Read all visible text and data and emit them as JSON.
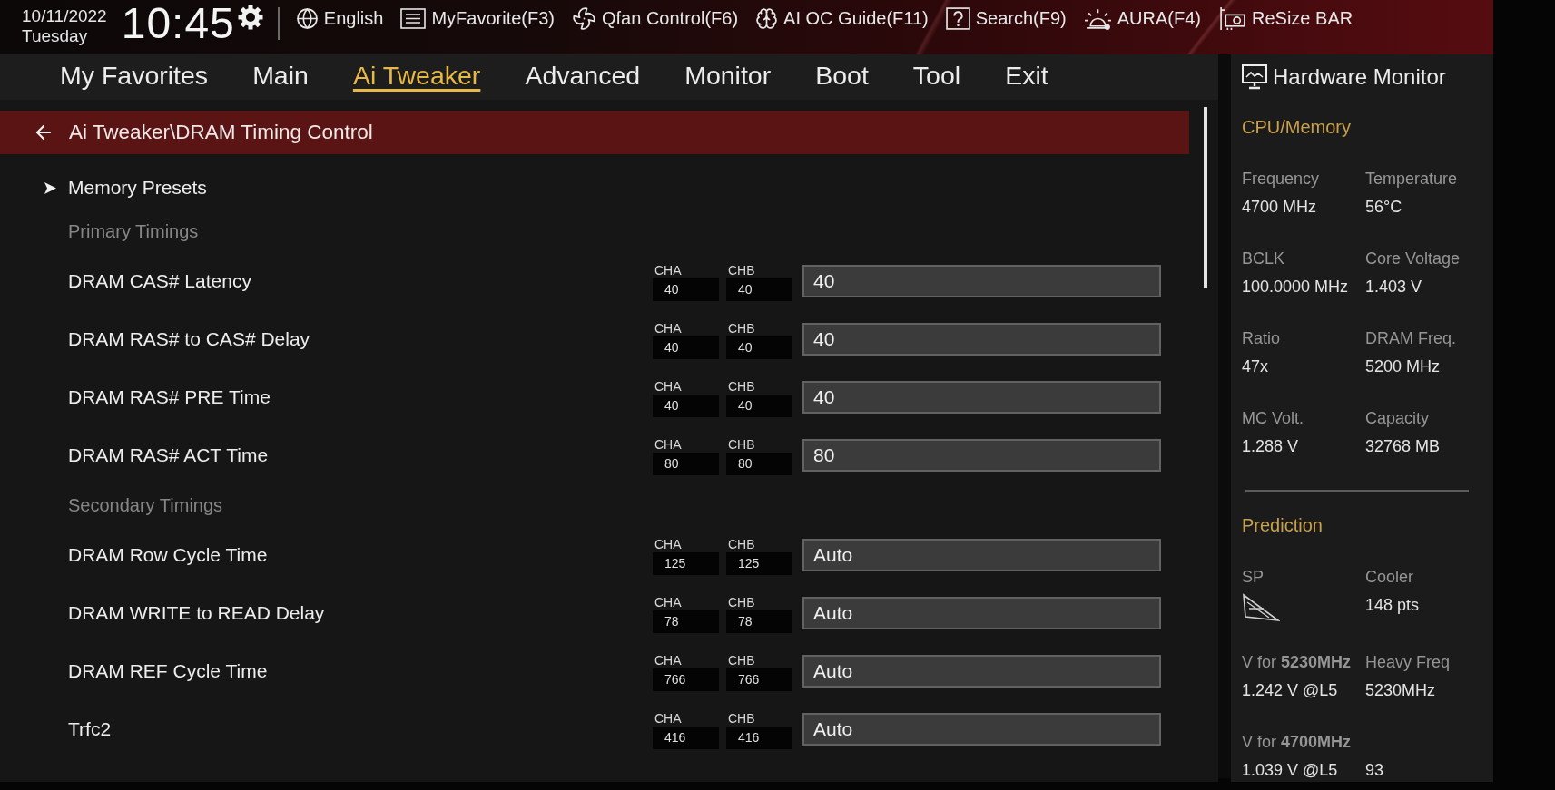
{
  "header": {
    "date": "10/11/2022",
    "day": "Tuesday",
    "time": "10:45",
    "tools": [
      {
        "kind": "language",
        "label": "English"
      },
      {
        "kind": "favorite",
        "label": "MyFavorite(F3)"
      },
      {
        "kind": "fan",
        "label": "Qfan Control(F6)"
      },
      {
        "kind": "guide",
        "label": "AI OC Guide(F11)"
      },
      {
        "kind": "search",
        "label": "Search(F9)"
      },
      {
        "kind": "aura",
        "label": "AURA(F4)"
      },
      {
        "kind": "resize",
        "label": "ReSize BAR"
      }
    ]
  },
  "menu": [
    {
      "label": "My Favorites",
      "selected": false
    },
    {
      "label": "Main",
      "selected": false
    },
    {
      "label": "Ai Tweaker",
      "selected": true
    },
    {
      "label": "Advanced",
      "selected": false
    },
    {
      "label": "Monitor",
      "selected": false
    },
    {
      "label": "Boot",
      "selected": false
    },
    {
      "label": "Tool",
      "selected": false
    },
    {
      "label": "Exit",
      "selected": false
    }
  ],
  "breadcrumb": "Ai Tweaker\\DRAM Timing Control",
  "items": [
    {
      "kind": "submenu",
      "label": "Memory Presets"
    },
    {
      "kind": "heading",
      "label": "Primary Timings"
    },
    {
      "kind": "timing",
      "label": "DRAM CAS# Latency",
      "channels": [
        {
          "name": "CHA",
          "value": "40"
        },
        {
          "name": "CHB",
          "value": "40"
        }
      ],
      "value": "40"
    },
    {
      "kind": "timing",
      "label": "DRAM RAS# to CAS# Delay",
      "channels": [
        {
          "name": "CHA",
          "value": "40"
        },
        {
          "name": "CHB",
          "value": "40"
        }
      ],
      "value": "40"
    },
    {
      "kind": "timing",
      "label": "DRAM RAS# PRE Time",
      "channels": [
        {
          "name": "CHA",
          "value": "40"
        },
        {
          "name": "CHB",
          "value": "40"
        }
      ],
      "value": "40"
    },
    {
      "kind": "timing",
      "label": "DRAM RAS# ACT Time",
      "channels": [
        {
          "name": "CHA",
          "value": "80"
        },
        {
          "name": "CHB",
          "value": "80"
        }
      ],
      "value": "80"
    },
    {
      "kind": "heading",
      "label": "Secondary Timings"
    },
    {
      "kind": "timing",
      "label": "DRAM Row Cycle Time",
      "channels": [
        {
          "name": "CHA",
          "value": "125"
        },
        {
          "name": "CHB",
          "value": "125"
        }
      ],
      "value": "Auto"
    },
    {
      "kind": "timing",
      "label": "DRAM WRITE to READ Delay",
      "channels": [
        {
          "name": "CHA",
          "value": "78"
        },
        {
          "name": "CHB",
          "value": "78"
        }
      ],
      "value": "Auto"
    },
    {
      "kind": "timing",
      "label": "DRAM REF Cycle Time",
      "channels": [
        {
          "name": "CHA",
          "value": "766"
        },
        {
          "name": "CHB",
          "value": "766"
        }
      ],
      "value": "Auto"
    },
    {
      "kind": "timing",
      "label": "Trfc2",
      "channels": [
        {
          "name": "CHA",
          "value": "416"
        },
        {
          "name": "CHB",
          "value": "416"
        }
      ],
      "value": "Auto"
    }
  ],
  "monitor": {
    "title": "Hardware Monitor",
    "sections": [
      {
        "title": "CPU/Memory",
        "stats": [
          {
            "kind": "text",
            "label": "Frequency",
            "value": "4700 MHz"
          },
          {
            "kind": "text",
            "label": "Temperature",
            "value": "56°C"
          },
          {
            "kind": "text",
            "label": "BCLK",
            "value": "100.0000 MHz"
          },
          {
            "kind": "text",
            "label": "Core Voltage",
            "value": "1.403 V"
          },
          {
            "kind": "text",
            "label": "Ratio",
            "value": "47x"
          },
          {
            "kind": "text",
            "label": "DRAM Freq.",
            "value": "5200 MHz"
          },
          {
            "kind": "text",
            "label": "MC Volt.",
            "value": "1.288 V"
          },
          {
            "kind": "text",
            "label": "Capacity",
            "value": "32768 MB"
          }
        ]
      },
      {
        "title": "Prediction",
        "stats": [
          {
            "kind": "icon",
            "label": "SP"
          },
          {
            "kind": "text",
            "label": "Cooler",
            "value": "148 pts"
          },
          {
            "kind": "text",
            "label": "V for **5230MHz**",
            "value": "1.242 V @L5"
          },
          {
            "kind": "text",
            "label": "Heavy Freq",
            "value": "5230MHz"
          },
          {
            "kind": "text",
            "label": "V for **4700MHz**",
            "value": "1.039 V @L5"
          },
          {
            "kind": "text",
            "value": "93"
          }
        ]
      }
    ]
  }
}
